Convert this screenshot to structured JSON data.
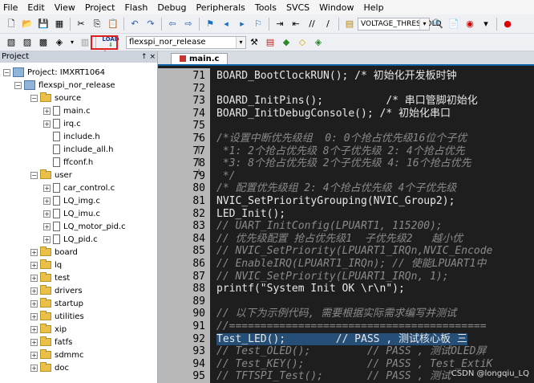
{
  "menubar": {
    "items": [
      "File",
      "Edit",
      "View",
      "Project",
      "Flash",
      "Debug",
      "Peripherals",
      "Tools",
      "SVCS",
      "Window",
      "Help"
    ]
  },
  "toolbar": {
    "search_text": "VOLTAGE_THRESHOLD"
  },
  "toolbar2": {
    "target": "flexspi_nor_release",
    "load_icon_label": "LOAD"
  },
  "project_panel": {
    "header": "Project",
    "pins": "↑ ×",
    "tree": [
      {
        "label": "Project: IMXRT1064",
        "level": 0,
        "icon": "project-icon",
        "toggle": "-"
      },
      {
        "label": "flexspi_nor_release",
        "level": 1,
        "icon": "target-icon",
        "toggle": "-"
      },
      {
        "label": "source",
        "level": 2,
        "icon": "folder-icon",
        "toggle": "-"
      },
      {
        "label": "main.c",
        "level": 3,
        "icon": "file-icon",
        "toggle": "+"
      },
      {
        "label": "irq.c",
        "level": 3,
        "icon": "file-icon",
        "toggle": "+"
      },
      {
        "label": "include.h",
        "level": 3,
        "icon": "file-icon",
        "toggle": ""
      },
      {
        "label": "include_all.h",
        "level": 3,
        "icon": "file-icon",
        "toggle": ""
      },
      {
        "label": "ffconf.h",
        "level": 3,
        "icon": "file-icon",
        "toggle": ""
      },
      {
        "label": "user",
        "level": 2,
        "icon": "folder-icon",
        "toggle": "-"
      },
      {
        "label": "car_control.c",
        "level": 3,
        "icon": "file-icon",
        "toggle": "+"
      },
      {
        "label": "LQ_img.c",
        "level": 3,
        "icon": "file-icon",
        "toggle": "+"
      },
      {
        "label": "LQ_imu.c",
        "level": 3,
        "icon": "file-icon",
        "toggle": "+"
      },
      {
        "label": "LQ_motor_pid.c",
        "level": 3,
        "icon": "file-icon",
        "toggle": "+"
      },
      {
        "label": "LQ_pid.c",
        "level": 3,
        "icon": "file-icon",
        "toggle": "+"
      },
      {
        "label": "board",
        "level": 2,
        "icon": "folder-icon",
        "toggle": "+"
      },
      {
        "label": "lq",
        "level": 2,
        "icon": "folder-icon",
        "toggle": "+"
      },
      {
        "label": "test",
        "level": 2,
        "icon": "folder-icon",
        "toggle": "+"
      },
      {
        "label": "drivers",
        "level": 2,
        "icon": "folder-icon",
        "toggle": "+"
      },
      {
        "label": "startup",
        "level": 2,
        "icon": "folder-icon",
        "toggle": "+"
      },
      {
        "label": "utilities",
        "level": 2,
        "icon": "folder-icon",
        "toggle": "+"
      },
      {
        "label": "xip",
        "level": 2,
        "icon": "folder-icon",
        "toggle": "+"
      },
      {
        "label": "fatfs",
        "level": 2,
        "icon": "folder-icon",
        "toggle": "+"
      },
      {
        "label": "sdmmc",
        "level": 2,
        "icon": "folder-icon",
        "toggle": "+"
      },
      {
        "label": "doc",
        "level": 2,
        "icon": "folder-icon",
        "toggle": "+"
      }
    ]
  },
  "editor": {
    "tab": "main.c",
    "lines": [
      {
        "n": "71",
        "text": "BOARD_BootClockRUN(); /* 初始化开发板时钟",
        "kind": "mixed",
        "fold": ""
      },
      {
        "n": "72",
        "text": "",
        "kind": "code",
        "fold": ""
      },
      {
        "n": "73",
        "text": "BOARD_InitPins();          /* 串口管脚初始化",
        "kind": "mixed",
        "fold": ""
      },
      {
        "n": "74",
        "text": "BOARD_InitDebugConsole(); /* 初始化串口",
        "kind": "mixed",
        "fold": ""
      },
      {
        "n": "75",
        "text": "",
        "kind": "code",
        "fold": ""
      },
      {
        "n": "76",
        "text": "/*设置中断优先级组  0: 0个抢占优先级16位个子优",
        "kind": "comment",
        "fold": "−"
      },
      {
        "n": "77",
        "text": " *1: 2个抢占优先级 8个子优先级 2: 4个抢占优先",
        "kind": "comment",
        "fold": "|"
      },
      {
        "n": "78",
        "text": " *3: 8个抢占优先级 2个子优先级 4: 16个抢占优先",
        "kind": "comment",
        "fold": "|"
      },
      {
        "n": "79",
        "text": " */",
        "kind": "comment",
        "fold": "└"
      },
      {
        "n": "80",
        "text": "/* 配置优先级组 2: 4个抢占优先级 4个子优先级",
        "kind": "comment",
        "fold": ""
      },
      {
        "n": "81",
        "text": "NVIC_SetPriorityGrouping(NVIC_Group2);",
        "kind": "code",
        "fold": ""
      },
      {
        "n": "82",
        "text": "LED_Init();",
        "kind": "code",
        "fold": ""
      },
      {
        "n": "83",
        "text": "// UART_InitConfig(LPUART1, 115200);",
        "kind": "comment",
        "fold": ""
      },
      {
        "n": "84",
        "text": "// 优先级配置 抢占优先级1  子优先级2   越小优",
        "kind": "comment",
        "fold": ""
      },
      {
        "n": "85",
        "text": "// NVIC_SetPriority(LPUART1_IRQn,NVIC_Encode",
        "kind": "comment",
        "fold": ""
      },
      {
        "n": "86",
        "text": "// EnableIRQ(LPUART1_IRQn); // 使能LPUART1中",
        "kind": "comment",
        "fold": ""
      },
      {
        "n": "87",
        "text": "// NVIC_SetPriority(LPUART1_IRQn, 1);",
        "kind": "comment",
        "fold": ""
      },
      {
        "n": "88",
        "text": "printf(\"System Init OK \\r\\n\");",
        "kind": "code",
        "fold": ""
      },
      {
        "n": "89",
        "text": "",
        "kind": "code",
        "fold": ""
      },
      {
        "n": "90",
        "text": "// 以下为示例代码, 需要根据实际需求编写并测试",
        "kind": "comment",
        "fold": ""
      },
      {
        "n": "91",
        "text": "//=========================================",
        "kind": "comment",
        "fold": ""
      },
      {
        "n": "92",
        "text": "Test_LED();        // PASS , 测试核心板 三",
        "kind": "mixed",
        "fold": ""
      },
      {
        "n": "93",
        "text": "// Test_OLED();         // PASS , 测试OLED屏",
        "kind": "comment",
        "fold": ""
      },
      {
        "n": "94",
        "text": "// Test_KEY();          // PASS , Test_ExtiK",
        "kind": "comment",
        "fold": ""
      },
      {
        "n": "95",
        "text": "// TFTSPI_Test();       // PASS , 测试",
        "kind": "comment",
        "fold": ""
      }
    ]
  },
  "watermark": "CSDN @longqiu_LQ",
  "colors": {
    "annotation_red": "#e02020",
    "code_bg": "#1e1e1e",
    "gutter_bg": "#b8b8b8"
  }
}
